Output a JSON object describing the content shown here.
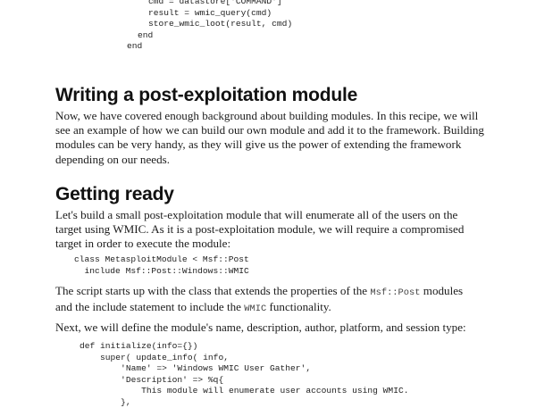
{
  "code_top": {
    "lines": [
      "cmd = datastore['COMMAND']",
      "result = wmic_query(cmd)",
      "store_wmic_loot(result, cmd)",
      "end",
      "end"
    ]
  },
  "section1": {
    "heading": "Writing a post-exploitation module",
    "body_lines": [
      "Now, we have covered enough background about building modules. In this recipe, we will",
      "see an example of how we can build our own module and add it to the framework. Building",
      "modules can be very handy, as they will give us the power of extending the framework",
      "depending on our needs."
    ]
  },
  "section2": {
    "heading": "Getting ready",
    "intro_lines": [
      "Let's build a small post-exploitation module that will enumerate all of the users on the",
      "target using WMIC. As it is a post-exploitation module, we will require a compromised",
      "target in order to execute the module:"
    ],
    "code1_lines": [
      "class MetasploitModule < Msf::Post",
      "  include Msf::Post::Windows::WMIC"
    ],
    "script_para": {
      "l1_a": "The script starts up with the class that extends the properties of the ",
      "l1_code": "Msf::Post",
      "l1_b": " modules",
      "l2_a": "and the include statement to include the ",
      "l2_code": "WMIC",
      "l2_b": " functionality."
    },
    "next_para": "Next, we will define the module's name, description, author, platform, and session type:",
    "code2_lines": [
      "def initialize(info={})",
      "    super( update_info( info,",
      "        'Name' => 'Windows WMIC User Gather',",
      "        'Description' => %q{",
      "            This module will enumerate user accounts using WMIC.",
      "        },"
    ]
  }
}
